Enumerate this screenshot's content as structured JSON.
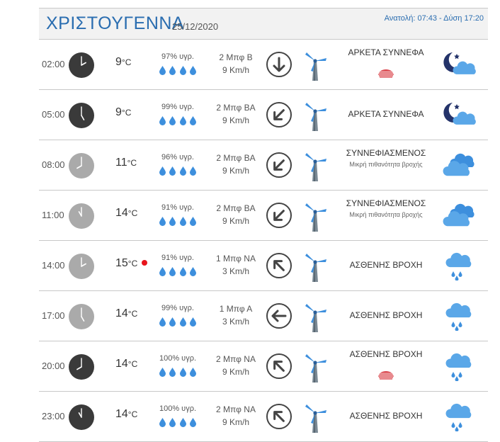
{
  "header": {
    "title": "ΧΡΙΣΤΟΥΓΕΝΝΑ",
    "date": "25/12/2020",
    "sun": "Ανατολή: 07:43  - Δύση 17:20"
  },
  "colors": {
    "accent": "#2a6db0",
    "clock_dark": "#3a3a3a",
    "clock_light": "#aaaaaa",
    "drop": "#3d8fdd",
    "alert": "#e8141c",
    "haze": "#d9434a"
  },
  "rows": [
    {
      "time": "02:00",
      "clock": "dark",
      "clock_hour": 2,
      "temp": "9",
      "unit": "°C",
      "alert": false,
      "humidity": "97% υγρ.",
      "drops": 4,
      "wind": "2 Μπφ Β",
      "wind_kmh": "9 Km/h",
      "wind_dir": "N",
      "arrow": "down",
      "condition": "ΑΡΚΕΤΑ ΣΥΝΝΕΦΑ",
      "sub": "",
      "haze": true,
      "icon": "moon-cloud-icon"
    },
    {
      "time": "05:00",
      "clock": "dark",
      "clock_hour": 5,
      "temp": "9",
      "unit": "°C",
      "alert": false,
      "humidity": "99% υγρ.",
      "drops": 4,
      "wind": "2 Μπφ ΒΑ",
      "wind_kmh": "9 Km/h",
      "wind_dir": "NE",
      "arrow": "down-left",
      "condition": "ΑΡΚΕΤΑ ΣΥΝΝΕΦΑ",
      "sub": "",
      "haze": false,
      "icon": "moon-cloud-icon"
    },
    {
      "time": "08:00",
      "clock": "light",
      "clock_hour": 8,
      "temp": "11",
      "unit": "°C",
      "alert": false,
      "humidity": "96% υγρ.",
      "drops": 4,
      "wind": "2 Μπφ ΒΑ",
      "wind_kmh": "9 Km/h",
      "wind_dir": "NE",
      "arrow": "down-left",
      "condition": "ΣΥΝΝΕΦΙΑΣΜΕΝΟΣ",
      "sub": "Μικρή πιθανότητα βροχής",
      "haze": false,
      "icon": "clouds-icon"
    },
    {
      "time": "11:00",
      "clock": "light",
      "clock_hour": 11,
      "temp": "14",
      "unit": "°C",
      "alert": false,
      "humidity": "91% υγρ.",
      "drops": 4,
      "wind": "2 Μπφ ΒΑ",
      "wind_kmh": "9 Km/h",
      "wind_dir": "NE",
      "arrow": "down-left",
      "condition": "ΣΥΝΝΕΦΙΑΣΜΕΝΟΣ",
      "sub": "Μικρή πιθανότητα βροχής",
      "haze": false,
      "icon": "clouds-icon"
    },
    {
      "time": "14:00",
      "clock": "light",
      "clock_hour": 2,
      "temp": "15",
      "unit": "°C",
      "alert": true,
      "humidity": "91% υγρ.",
      "drops": 4,
      "wind": "1 Μπφ ΝΑ",
      "wind_kmh": "3 Km/h",
      "wind_dir": "SE",
      "arrow": "up-left",
      "condition": "ΑΣΘΕΝΗΣ ΒΡΟΧΗ",
      "sub": "",
      "haze": false,
      "icon": "rain-cloud-icon"
    },
    {
      "time": "17:00",
      "clock": "light",
      "clock_hour": 5,
      "temp": "14",
      "unit": "°C",
      "alert": false,
      "humidity": "99% υγρ.",
      "drops": 4,
      "wind": "1 Μπφ Α",
      "wind_kmh": "3 Km/h",
      "wind_dir": "E",
      "arrow": "left",
      "condition": "ΑΣΘΕΝΗΣ ΒΡΟΧΗ",
      "sub": "",
      "haze": false,
      "icon": "rain-cloud-icon"
    },
    {
      "time": "20:00",
      "clock": "dark",
      "clock_hour": 8,
      "temp": "14",
      "unit": "°C",
      "alert": false,
      "humidity": "100% υγρ.",
      "drops": 4,
      "wind": "2 Μπφ ΝΑ",
      "wind_kmh": "9 Km/h",
      "wind_dir": "SE",
      "arrow": "up-left",
      "condition": "ΑΣΘΕΝΗΣ ΒΡΟΧΗ",
      "sub": "",
      "haze": true,
      "icon": "rain-cloud-icon"
    },
    {
      "time": "23:00",
      "clock": "dark",
      "clock_hour": 11,
      "temp": "14",
      "unit": "°C",
      "alert": false,
      "humidity": "100% υγρ.",
      "drops": 4,
      "wind": "2 Μπφ ΝΑ",
      "wind_kmh": "9 Km/h",
      "wind_dir": "SE",
      "arrow": "up-left",
      "condition": "ΑΣΘΕΝΗΣ ΒΡΟΧΗ",
      "sub": "",
      "haze": false,
      "icon": "rain-cloud-icon"
    }
  ]
}
